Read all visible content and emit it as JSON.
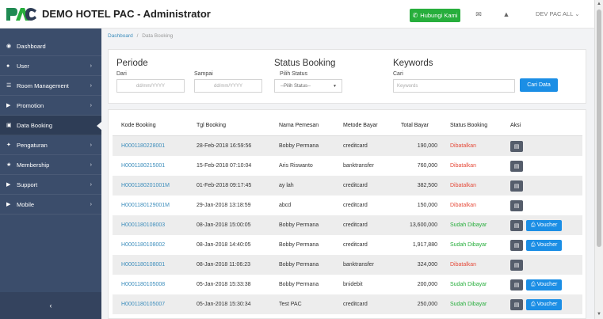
{
  "header": {
    "title": "DEMO HOTEL PAC - Administrator",
    "logo_text": "PAC",
    "contact_button": "Hubungi Kami",
    "user_menu": "DEV PAC ALL"
  },
  "sidebar": {
    "items": [
      {
        "label": "Dashboard",
        "icon": "dashboard-icon",
        "has_chevron": false
      },
      {
        "label": "User",
        "icon": "user-icon",
        "has_chevron": true
      },
      {
        "label": "Room Management",
        "icon": "list-icon",
        "has_chevron": true
      },
      {
        "label": "Promotion",
        "icon": "tag-icon",
        "has_chevron": true
      },
      {
        "label": "Data Booking",
        "icon": "book-icon",
        "has_chevron": false,
        "active": true
      },
      {
        "label": "Pengaturan",
        "icon": "wrench-icon",
        "has_chevron": true
      },
      {
        "label": "Membership",
        "icon": "star-icon",
        "has_chevron": true
      },
      {
        "label": "Support",
        "icon": "tag-icon",
        "has_chevron": true
      },
      {
        "label": "Mobile",
        "icon": "tag-icon",
        "has_chevron": true
      }
    ],
    "collapse_label": "‹"
  },
  "breadcrumb": {
    "home": "Dashboard",
    "separator": "/",
    "current": "Data Booking"
  },
  "filter": {
    "periode_title": "Periode",
    "dari_label": "Dari",
    "dari_placeholder": "dd/mm/YYYY",
    "sampai_label": "Sampai",
    "sampai_placeholder": "dd/mm/YYYY",
    "status_title": "Status Booking",
    "status_label": "Pilih Status",
    "status_value": "--Pilih Status--",
    "keywords_title": "Keywords",
    "cari_label": "Cari",
    "keywords_placeholder": "Keywords",
    "search_button": "Cari Data"
  },
  "table": {
    "headers": [
      "Kode Booking",
      "Tgl Booking",
      "Nama Pemesan",
      "Metode Bayar",
      "Total Bayar",
      "Status Booking",
      "Aksi"
    ],
    "rows": [
      {
        "kode": "H0001180228001",
        "tgl": "28-Feb-2018 16:59:56",
        "nama": "Bobby Permana",
        "metode": "creditcard",
        "total": "190,000",
        "status": "Dibatalkan",
        "status_type": "red",
        "voucher": false
      },
      {
        "kode": "H0001180215001",
        "tgl": "15-Feb-2018 07:10:04",
        "nama": "Aris Riswanto",
        "metode": "banktransfer",
        "total": "760,000",
        "status": "Dibatalkan",
        "status_type": "red",
        "voucher": false
      },
      {
        "kode": "H0001180201001M",
        "tgl": "01-Feb-2018 09:17:45",
        "nama": "ay lah",
        "metode": "creditcard",
        "total": "382,500",
        "status": "Dibatalkan",
        "status_type": "red",
        "voucher": false
      },
      {
        "kode": "H0001180129001M",
        "tgl": "29-Jan-2018 13:18:59",
        "nama": "abcd",
        "metode": "creditcard",
        "total": "150,000",
        "status": "Dibatalkan",
        "status_type": "red",
        "voucher": false
      },
      {
        "kode": "H0001180108003",
        "tgl": "08-Jan-2018 15:00:05",
        "nama": "Bobby Permana",
        "metode": "creditcard",
        "total": "13,600,000",
        "status": "Sudah Dibayar",
        "status_type": "green",
        "voucher": true
      },
      {
        "kode": "H0001180108002",
        "tgl": "08-Jan-2018 14:40:05",
        "nama": "Bobby Permana",
        "metode": "creditcard",
        "total": "1,917,880",
        "status": "Sudah Dibayar",
        "status_type": "green",
        "voucher": true
      },
      {
        "kode": "H0001180108001",
        "tgl": "08-Jan-2018 11:06:23",
        "nama": "Bobby Permana",
        "metode": "banktransfer",
        "total": "324,000",
        "status": "Dibatalkan",
        "status_type": "red",
        "voucher": false
      },
      {
        "kode": "H0001180105008",
        "tgl": "05-Jan-2018 15:33:38",
        "nama": "Bobby Permana",
        "metode": "bnidebit",
        "total": "200,000",
        "status": "Sudah Dibayar",
        "status_type": "green",
        "voucher": true
      },
      {
        "kode": "H0001180105007",
        "tgl": "05-Jan-2018 15:30:34",
        "nama": "Test PAC",
        "metode": "creditcard",
        "total": "250,000",
        "status": "Sudah Dibayar",
        "status_type": "green",
        "voucher": true
      }
    ],
    "voucher_label": "Voucher"
  },
  "colors": {
    "sidebar_bg": "#3b4d6b",
    "primary_blue": "#1b8ee5",
    "green": "#27ae3c",
    "red": "#e64c3c"
  }
}
